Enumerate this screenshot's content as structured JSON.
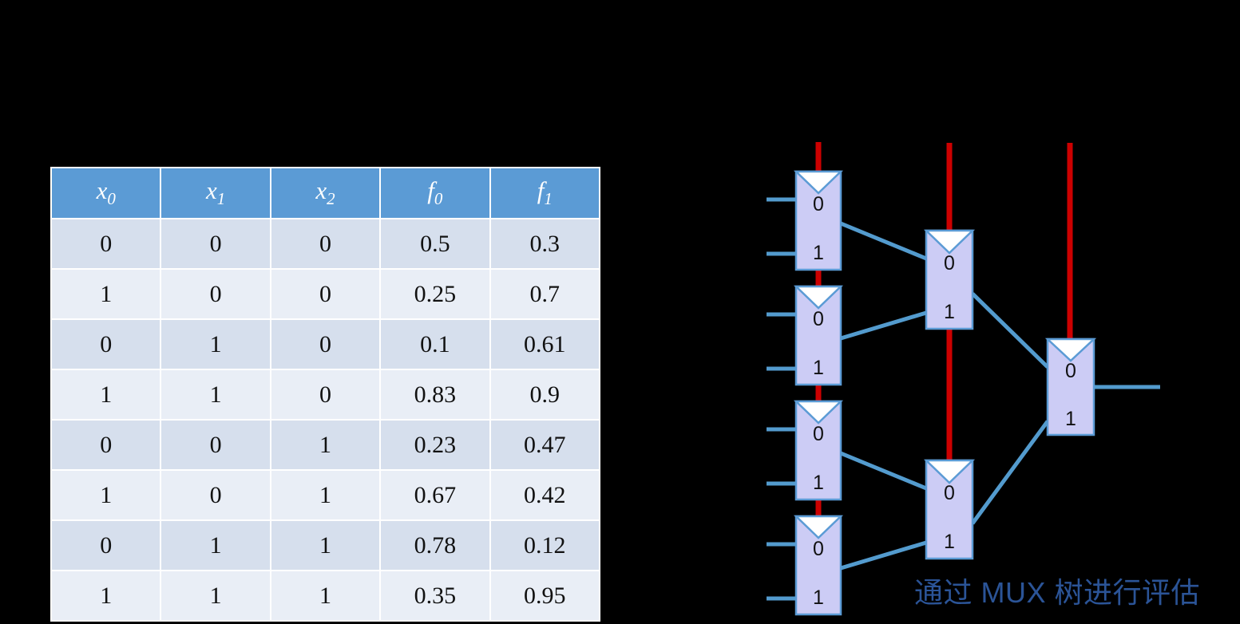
{
  "colors": {
    "background": "#000000",
    "table_header_bg": "#5B9BD5",
    "table_header_text": "#FFFFFF",
    "table_row_dark": "#D6DFED",
    "table_row_light": "#E9EEF6",
    "mux_fill": "#CCCCF5",
    "mux_stroke": "#5B9BD5",
    "wire_blue": "#539BCE",
    "wire_red": "#CC0000",
    "caption_text": "#2B5497"
  },
  "truth_table": {
    "headers": [
      {
        "base": "x",
        "sub": "0",
        "text": "x0"
      },
      {
        "base": "x",
        "sub": "1",
        "text": "x1"
      },
      {
        "base": "x",
        "sub": "2",
        "text": "x2"
      },
      {
        "base": "f",
        "sub": "0",
        "text": "f0"
      },
      {
        "base": "f",
        "sub": "1",
        "text": "f1"
      }
    ],
    "rows": [
      [
        "0",
        "0",
        "0",
        "0.5",
        "0.3"
      ],
      [
        "1",
        "0",
        "0",
        "0.25",
        "0.7"
      ],
      [
        "0",
        "1",
        "0",
        "0.1",
        "0.61"
      ],
      [
        "1",
        "1",
        "0",
        "0.83",
        "0.9"
      ],
      [
        "0",
        "0",
        "1",
        "0.23",
        "0.47"
      ],
      [
        "1",
        "0",
        "1",
        "0.67",
        "0.42"
      ],
      [
        "0",
        "1",
        "1",
        "0.78",
        "0.12"
      ],
      [
        "1",
        "1",
        "1",
        "0.35",
        "0.95"
      ]
    ]
  },
  "mux_tree": {
    "caption": "通过 MUX 树进行评估",
    "port_labels": {
      "zero": "0",
      "one": "1"
    },
    "stage1": [
      {
        "id": "mux-1",
        "label_top": "0",
        "label_bottom": "1"
      },
      {
        "id": "mux-2",
        "label_top": "0",
        "label_bottom": "1"
      },
      {
        "id": "mux-3",
        "label_top": "0",
        "label_bottom": "1"
      },
      {
        "id": "mux-4",
        "label_top": "0",
        "label_bottom": "1"
      }
    ],
    "stage2": [
      {
        "id": "mux-5",
        "label_top": "0",
        "label_bottom": "1"
      },
      {
        "id": "mux-6",
        "label_top": "0",
        "label_bottom": "1"
      }
    ],
    "stage3": [
      {
        "id": "mux-7",
        "label_top": "0",
        "label_bottom": "1"
      }
    ],
    "select_lines": 3,
    "input_stubs": 8,
    "output_stubs": 1
  }
}
